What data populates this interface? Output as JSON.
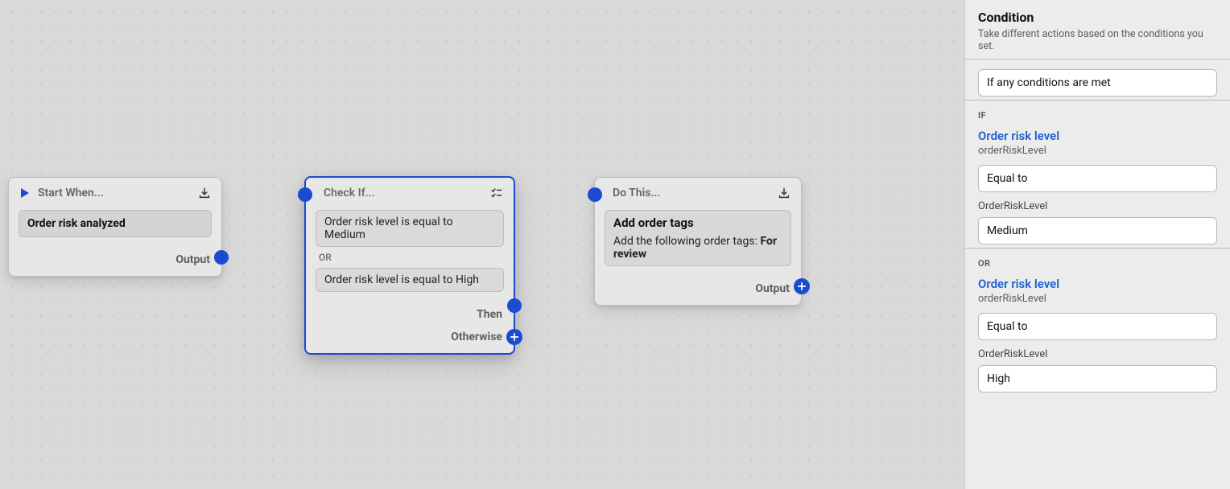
{
  "canvas": {
    "start_node": {
      "title": "Start When...",
      "trigger": "Order risk analyzed",
      "output_label": "Output"
    },
    "check_node": {
      "title": "Check If...",
      "conditions": [
        "Order risk level is equal to Medium",
        "Order risk level is equal to High"
      ],
      "or_label": "OR",
      "then_label": "Then",
      "otherwise_label": "Otherwise"
    },
    "action_node": {
      "title": "Do This...",
      "action_title": "Add order tags",
      "action_desc_prefix": "Add the following order tags: ",
      "action_desc_bold": "For review",
      "output_label": "Output"
    }
  },
  "side_panel": {
    "header_title": "Condition",
    "header_sub": "Take different actions based on the conditions you set.",
    "match_mode": "If any conditions are met",
    "if_section": {
      "label": "IF",
      "variable_label": "Order risk level",
      "variable_code": "orderRiskLevel",
      "operator": "Equal to",
      "value_field_label": "OrderRiskLevel",
      "value": "Medium"
    },
    "or_section": {
      "label": "OR",
      "variable_label": "Order risk level",
      "variable_code": "orderRiskLevel",
      "operator": "Equal to",
      "value_field_label": "OrderRiskLevel",
      "value": "High"
    }
  }
}
